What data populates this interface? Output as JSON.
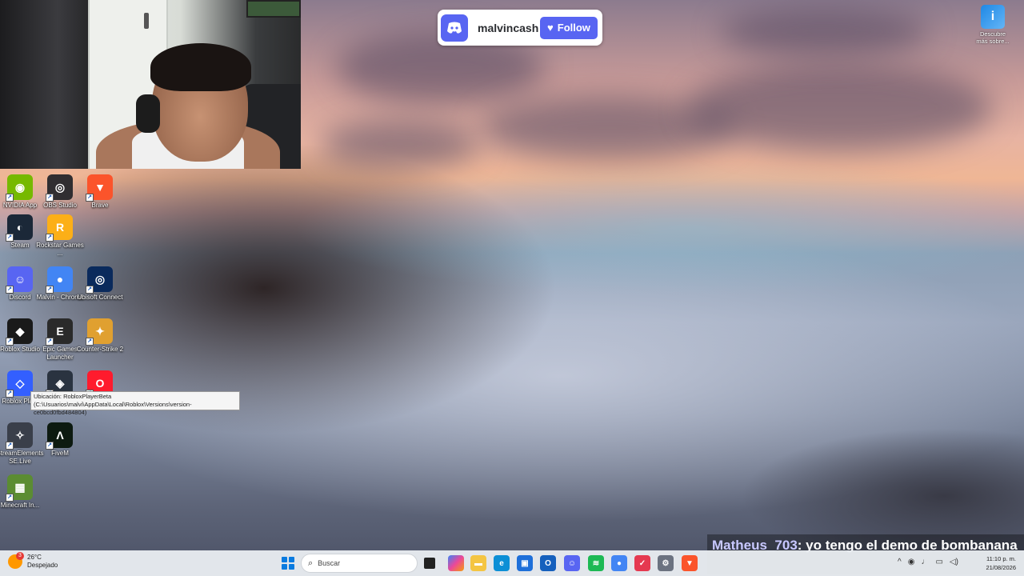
{
  "discord": {
    "username": "malvincash",
    "follow_label": "Follow"
  },
  "top_right_icon": {
    "label": "Descubre más sobre..."
  },
  "desktop": {
    "icons": [
      {
        "label": "NVIDIA App",
        "icon": "nvidia-icon",
        "color": "#76b900"
      },
      {
        "label": "OBS Studio",
        "icon": "obs-icon",
        "color": "#302e31"
      },
      {
        "label": "Brave",
        "icon": "brave-icon",
        "color": "#fb542b"
      },
      {
        "label": "Steam",
        "icon": "steam-icon",
        "color": "#1b2838"
      },
      {
        "label": "Rockstar Games ...",
        "icon": "rockstar-icon",
        "color": "#fcaf17"
      },
      {
        "label": "Discord",
        "icon": "discord-icon",
        "color": "#5865f2"
      },
      {
        "label": "Malvin - Chrome",
        "icon": "chrome-icon",
        "color": "#4285f4"
      },
      {
        "label": "Ubisoft Connect",
        "icon": "ubisoft-icon",
        "color": "#0a2a5c"
      },
      {
        "label": "Roblox Studio",
        "icon": "roblox-studio-icon",
        "color": "#1a1a1a"
      },
      {
        "label": "Epic Games Launcher",
        "icon": "epic-icon",
        "color": "#2a2a2a"
      },
      {
        "label": "Counter-Strike 2",
        "icon": "cs2-icon",
        "color": "#e0a030"
      },
      {
        "label": "Roblox Pla...",
        "icon": "roblox-player-icon",
        "color": "#335fff"
      },
      {
        "label": "",
        "icon": "davinci-icon",
        "color": "#2a3340"
      },
      {
        "label": "",
        "icon": "opera-icon",
        "color": "#ff1b2d"
      },
      {
        "label": "StreamElements SE.Live",
        "icon": "streamelements-icon",
        "color": "#3a3f4a"
      },
      {
        "label": "FiveM",
        "icon": "fivem-icon",
        "color": "#0d1a10"
      },
      {
        "label": "Minecraft In...",
        "icon": "minecraft-icon",
        "color": "#5b8c32"
      }
    ],
    "tooltip": "Ubicación: RobloxPlayerBeta (C:\\Usuarios\\malvi\\AppData\\Local\\Roblox\\Versions\\version-ce0bcd0fbd484804)"
  },
  "chat": {
    "user": "Matheus_703",
    "message": ": yo tengo el demo de bombanana"
  },
  "taskbar": {
    "weather": {
      "temp": "26°C",
      "condition": "Despejado",
      "badge": "3"
    },
    "search_placeholder": "Buscar",
    "apps": [
      {
        "name": "file-explorer",
        "icon": "folder-icon",
        "color": "#f4c542"
      },
      {
        "name": "edge",
        "icon": "edge-icon",
        "color": "#0c8fd6"
      },
      {
        "name": "store",
        "icon": "store-icon",
        "color": "#1e6fd9"
      },
      {
        "name": "outlook",
        "icon": "outlook-icon",
        "color": "#1560bd"
      },
      {
        "name": "discord",
        "icon": "discord-icon",
        "color": "#5865f2"
      },
      {
        "name": "spotify",
        "icon": "spotify-icon",
        "color": "#1db954"
      },
      {
        "name": "chrome",
        "icon": "chrome-icon",
        "color": "#4285f4"
      },
      {
        "name": "app-red",
        "icon": "app-icon",
        "color": "#e53950"
      },
      {
        "name": "settings",
        "icon": "gear-icon",
        "color": "#6b7280"
      },
      {
        "name": "brave",
        "icon": "brave-icon",
        "color": "#fb542b"
      }
    ],
    "time": "11:10 p. m.",
    "date": "21/08/2026"
  }
}
